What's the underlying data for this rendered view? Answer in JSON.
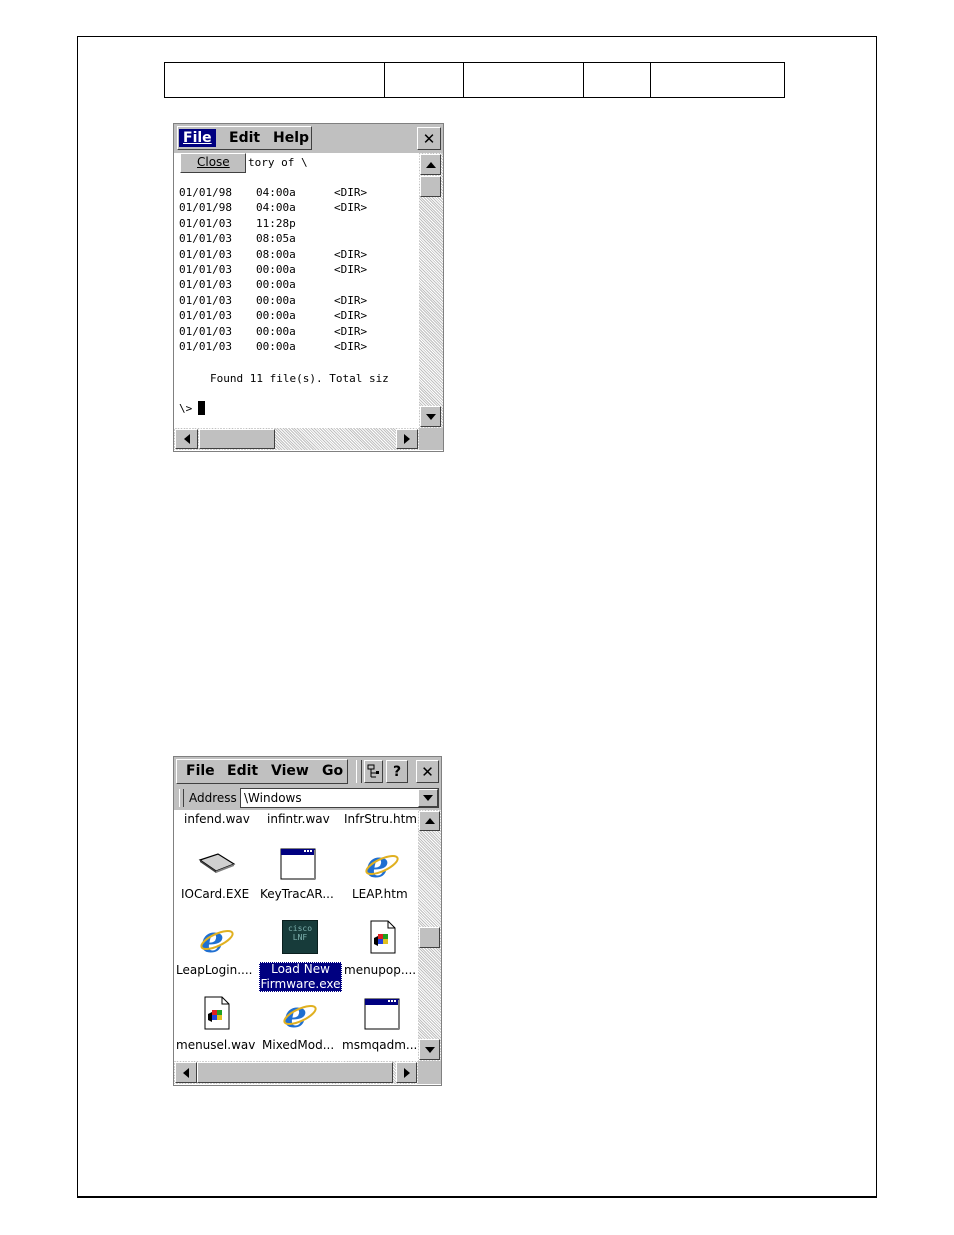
{
  "cmd_window": {
    "menu": [
      "File",
      "Edit",
      "Help"
    ],
    "close_glyph": "✕",
    "dropdown_item": "Close",
    "header_fragment": "tory of \\",
    "rows": [
      {
        "date": "01/01/98",
        "time": "04:00a",
        "tag": "<DIR>"
      },
      {
        "date": "01/01/98",
        "time": "04:00a",
        "tag": "<DIR>"
      },
      {
        "date": "01/01/03",
        "time": "11:28p",
        "tag": ""
      },
      {
        "date": "01/01/03",
        "time": "08:05a",
        "tag": ""
      },
      {
        "date": "01/01/03",
        "time": "08:00a",
        "tag": "<DIR>"
      },
      {
        "date": "01/01/03",
        "time": "00:00a",
        "tag": "<DIR>"
      },
      {
        "date": "01/01/03",
        "time": "00:00a",
        "tag": ""
      },
      {
        "date": "01/01/03",
        "time": "00:00a",
        "tag": "<DIR>"
      },
      {
        "date": "01/01/03",
        "time": "00:00a",
        "tag": "<DIR>"
      },
      {
        "date": "01/01/03",
        "time": "00:00a",
        "tag": "<DIR>"
      },
      {
        "date": "01/01/03",
        "time": "00:00a",
        "tag": "<DIR>"
      }
    ],
    "summary": "Found 11 file(s). Total siz",
    "prompt": "\\>"
  },
  "explorer_window": {
    "menu": [
      "File",
      "Edit",
      "View",
      "Go"
    ],
    "help_glyph": "?",
    "close_glyph": "✕",
    "address_label": "Address",
    "address_value": "\\Windows",
    "top_row": [
      "infend.wav",
      "infintr.wav",
      "InfrStru.htm"
    ],
    "files": [
      {
        "label": "IOCard.EXE",
        "icon": "card-icon"
      },
      {
        "label": "KeyTracAR...",
        "icon": "window-app-icon"
      },
      {
        "label": "LEAP.htm",
        "icon": "ie-icon"
      },
      {
        "label": "LeapLogin....",
        "icon": "ie-icon"
      },
      {
        "label_line1": "Load New",
        "label_line2": "Firmware.exe",
        "icon": "cisco-firmware-icon",
        "selected": true
      },
      {
        "label": "menupop....",
        "icon": "sound-file-icon"
      },
      {
        "label": "menusel.wav",
        "icon": "sound-file-icon"
      },
      {
        "label": "MixedMod...",
        "icon": "ie-icon"
      },
      {
        "label": "msmqadm....",
        "icon": "window-app-icon"
      }
    ],
    "cisco_text_line1": "cisco",
    "cisco_text_line2": "LNF"
  },
  "colors": {
    "selection": "#000080",
    "chrome": "#c0c0c0",
    "ie_blue": "#1f6fd1"
  }
}
